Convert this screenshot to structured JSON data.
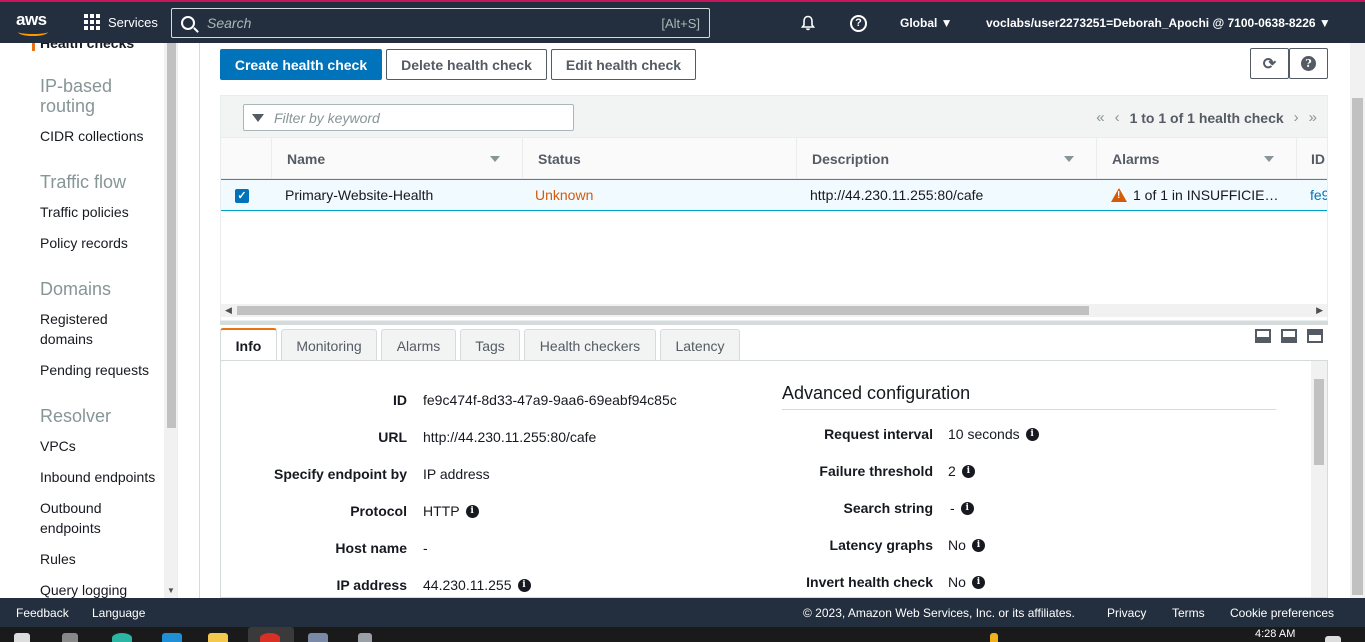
{
  "topnav": {
    "logo": "aws",
    "services": "Services",
    "search_placeholder": "Search",
    "search_shortcut": "[Alt+S]",
    "region": "Global ▼",
    "account": "voclabs/user2273251=Deborah_Apochi @ 7100-0638-8226 ▼",
    "icons": [
      "bell-icon",
      "help-icon"
    ]
  },
  "sidebar": {
    "cutoff_item": "Health checks",
    "sections": [
      {
        "heading": "IP-based routing",
        "items": [
          "CIDR collections"
        ]
      },
      {
        "heading": "Traffic flow",
        "items": [
          "Traffic policies",
          "Policy records"
        ]
      },
      {
        "heading": "Domains",
        "items": [
          "Registered domains",
          "Pending requests"
        ]
      },
      {
        "heading": "Resolver",
        "items": [
          "VPCs",
          "Inbound endpoints",
          "Outbound endpoints",
          "Rules",
          "Query logging"
        ]
      }
    ]
  },
  "toolbar": {
    "create": "Create health check",
    "delete": "Delete health check",
    "edit": "Edit health check",
    "refresh_icon": "refresh-icon",
    "help_icon": "help-icon"
  },
  "table": {
    "filter_placeholder": "Filter by keyword",
    "pagination": "1 to 1 of 1 health check",
    "columns": [
      "Name",
      "Status",
      "Description",
      "Alarms",
      "ID"
    ],
    "rows": [
      {
        "selected": true,
        "name": "Primary-Website-Health",
        "status": "Unknown",
        "description": "http://44.230.11.255:80/cafe",
        "alarms": "1 of 1 in INSUFFICIE…",
        "id": "fe9"
      }
    ]
  },
  "detail": {
    "tabs": [
      "Info",
      "Monitoring",
      "Alarms",
      "Tags",
      "Health checkers",
      "Latency"
    ],
    "active_tab": "Info",
    "left": [
      {
        "label": "ID",
        "value": "fe9c474f-8d33-47a9-9aa6-69eabf94c85c",
        "info": false
      },
      {
        "label": "URL",
        "value": "http://44.230.11.255:80/cafe",
        "info": false
      },
      {
        "label": "Specify endpoint by",
        "value": "IP address",
        "info": false
      },
      {
        "label": "Protocol",
        "value": "HTTP",
        "info": true
      },
      {
        "label": "Host name",
        "value": "-",
        "info": false
      },
      {
        "label": "IP address",
        "value": "44.230.11.255",
        "info": true
      }
    ],
    "advanced_title": "Advanced configuration",
    "right": [
      {
        "label": "Request interval",
        "value": "10 seconds",
        "info": true
      },
      {
        "label": "Failure threshold",
        "value": "2",
        "info": true
      },
      {
        "label": "Search string",
        "value": "-",
        "info": true
      },
      {
        "label": "Latency graphs",
        "value": "No",
        "info": true
      },
      {
        "label": "Invert health check",
        "value": "No",
        "info": true
      }
    ]
  },
  "footer": {
    "feedback": "Feedback",
    "language": "Language",
    "copyright": "© 2023, Amazon Web Services, Inc. or its affiliates.",
    "privacy": "Privacy",
    "terms": "Terms",
    "cookies": "Cookie preferences"
  },
  "taskbar": {
    "clock": "4:28 AM"
  },
  "colors": {
    "nav_bg": "#232f3e",
    "primary": "#0073bb",
    "status_unknown": "#d45b07",
    "accent": "#ec7211"
  }
}
